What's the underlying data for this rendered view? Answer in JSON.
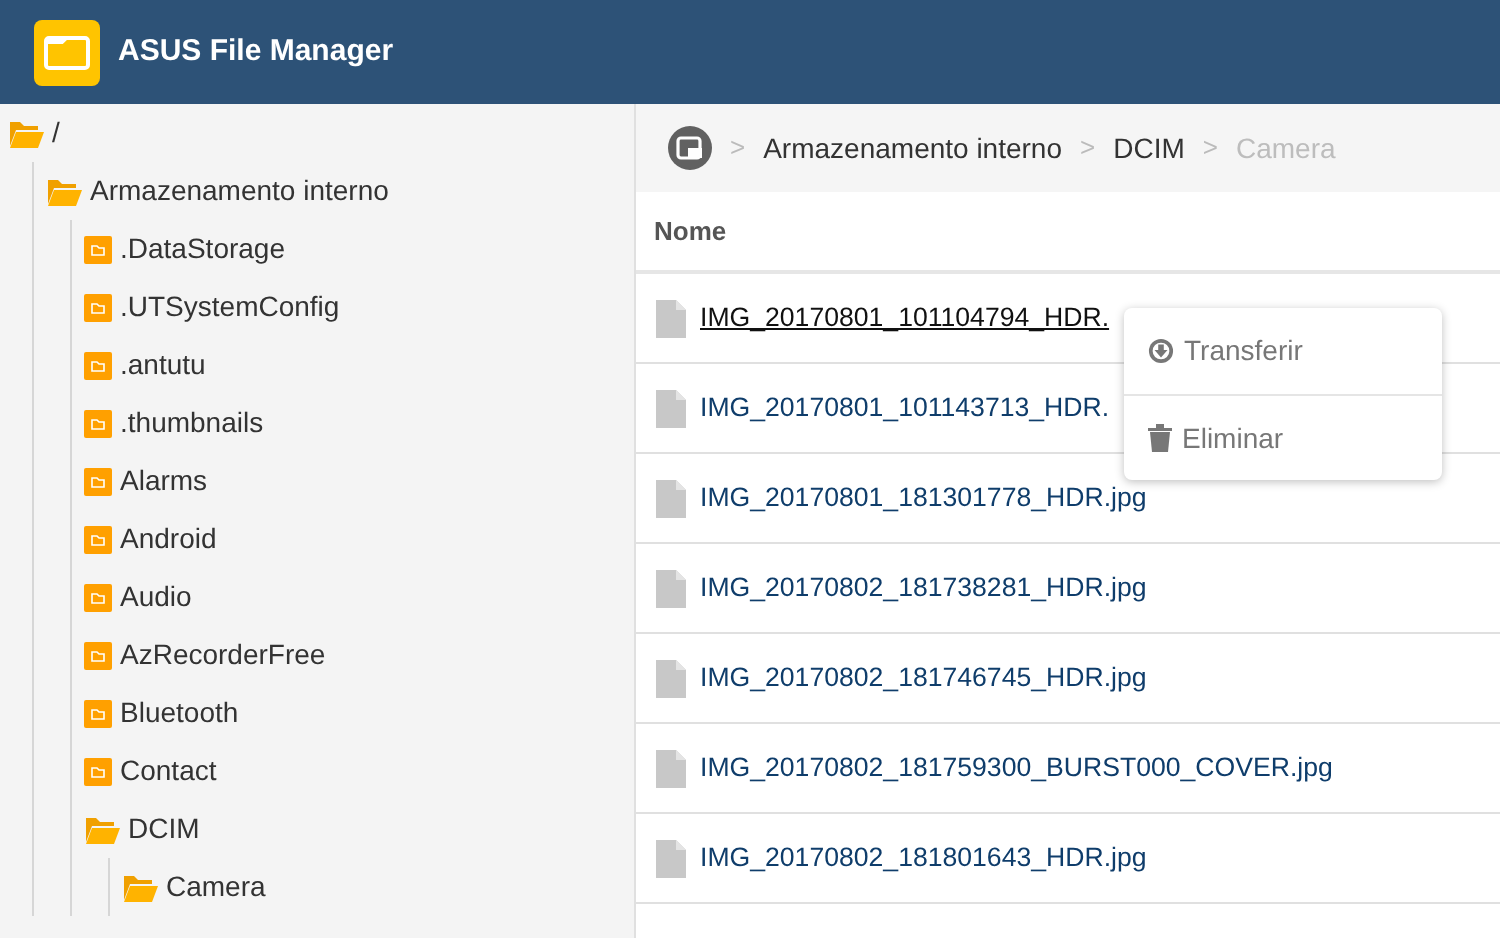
{
  "app": {
    "title": "ASUS File Manager"
  },
  "tree": [
    {
      "label": "/",
      "expanded": true,
      "children": [
        {
          "label": "Armazenamento interno",
          "expanded": true,
          "children": [
            {
              "label": ".DataStorage",
              "expanded": false
            },
            {
              "label": ".UTSystemConfig",
              "expanded": false
            },
            {
              "label": ".antutu",
              "expanded": false
            },
            {
              "label": ".thumbnails",
              "expanded": false
            },
            {
              "label": "Alarms",
              "expanded": false
            },
            {
              "label": "Android",
              "expanded": false
            },
            {
              "label": "Audio",
              "expanded": false
            },
            {
              "label": "AzRecorderFree",
              "expanded": false
            },
            {
              "label": "Bluetooth",
              "expanded": false
            },
            {
              "label": "Contact",
              "expanded": false
            },
            {
              "label": "DCIM",
              "expanded": true,
              "children": [
                {
                  "label": "Camera",
                  "expanded": true
                }
              ]
            }
          ]
        }
      ]
    }
  ],
  "breadcrumb": [
    {
      "label": ">",
      "kind": "separator"
    },
    {
      "label": "Armazenamento interno",
      "kind": "crumb",
      "current": false
    },
    {
      "label": ">",
      "kind": "separator"
    },
    {
      "label": "DCIM",
      "kind": "crumb",
      "current": false
    },
    {
      "label": ">",
      "kind": "separator"
    },
    {
      "label": "Camera",
      "kind": "crumb",
      "current": true
    }
  ],
  "table": {
    "columns": [
      "Nome"
    ],
    "rows": [
      {
        "name": "IMG_20170801_101104794_HDR.",
        "hovered": true
      },
      {
        "name": "IMG_20170801_101143713_HDR.",
        "hovered": false
      },
      {
        "name": "IMG_20170801_181301778_HDR.jpg",
        "hovered": false
      },
      {
        "name": "IMG_20170802_181738281_HDR.jpg",
        "hovered": false
      },
      {
        "name": "IMG_20170802_181746745_HDR.jpg",
        "hovered": false
      },
      {
        "name": "IMG_20170802_181759300_BURST000_COVER.jpg",
        "hovered": false
      },
      {
        "name": "IMG_20170802_181801643_HDR.jpg",
        "hovered": false
      }
    ]
  },
  "context_menu": [
    {
      "label": "Transferir",
      "kind": "download"
    },
    {
      "label": "Eliminar",
      "kind": "delete"
    }
  ]
}
